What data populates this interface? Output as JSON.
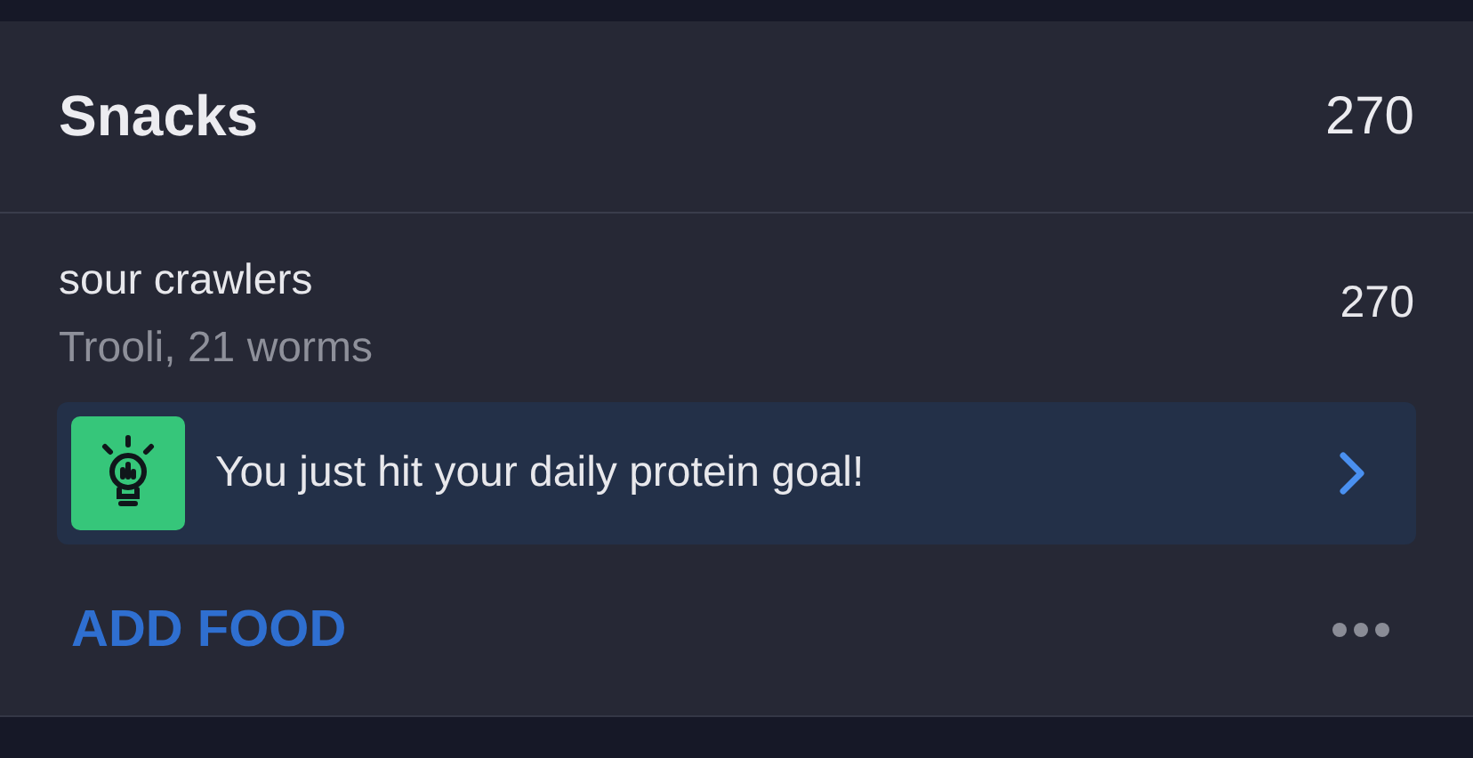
{
  "meal": {
    "title": "Snacks",
    "calories": "270"
  },
  "entries": [
    {
      "name": "sour crawlers",
      "detail": "Trooli, 21 worms",
      "calories": "270"
    }
  ],
  "banner": {
    "message": "You just hit your daily protein goal!"
  },
  "add_button": "ADD FOOD"
}
